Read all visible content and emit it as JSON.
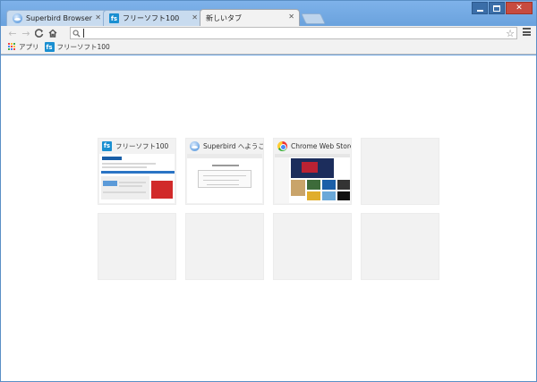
{
  "window": {
    "controls": [
      "minimize",
      "maximize",
      "close"
    ]
  },
  "tabs": [
    {
      "label": "Superbird Browser",
      "icon": "superbird-favicon",
      "active": false
    },
    {
      "label": "フリーソフト100",
      "icon": "fs-favicon",
      "active": false
    },
    {
      "label": "新しいタブ",
      "icon": "",
      "active": true
    }
  ],
  "toolbar": {
    "back": "←",
    "forward": "→",
    "reload": "C",
    "home": "⌂",
    "search_icon": "🔍",
    "omnibox_value": "",
    "star": "☆"
  },
  "bookmarks": {
    "apps_label": "アプリ",
    "items": [
      {
        "label": "フリーソフト100",
        "icon": "fs-favicon"
      }
    ]
  },
  "most_visited": [
    {
      "title": "フリーソフト100",
      "icon": "fs-favicon",
      "thumb": "fs"
    },
    {
      "title": "Superbird へようこそ",
      "icon": "superbird-favicon",
      "thumb": "sb"
    },
    {
      "title": "Chrome Web Store",
      "icon": "chrome-web-store-favicon",
      "thumb": "cws"
    },
    {
      "title": "",
      "icon": "",
      "thumb": ""
    },
    {
      "title": "",
      "icon": "",
      "thumb": ""
    },
    {
      "title": "",
      "icon": "",
      "thumb": ""
    },
    {
      "title": "",
      "icon": "",
      "thumb": ""
    },
    {
      "title": "",
      "icon": "",
      "thumb": ""
    }
  ],
  "favicon_text": {
    "fs": "fs"
  },
  "colors": {
    "frame": "#6ea5e0",
    "toolbar": "#f2f2f2",
    "tile_bg": "#f2f2f2",
    "fs_blue": "#1a8fd1"
  }
}
